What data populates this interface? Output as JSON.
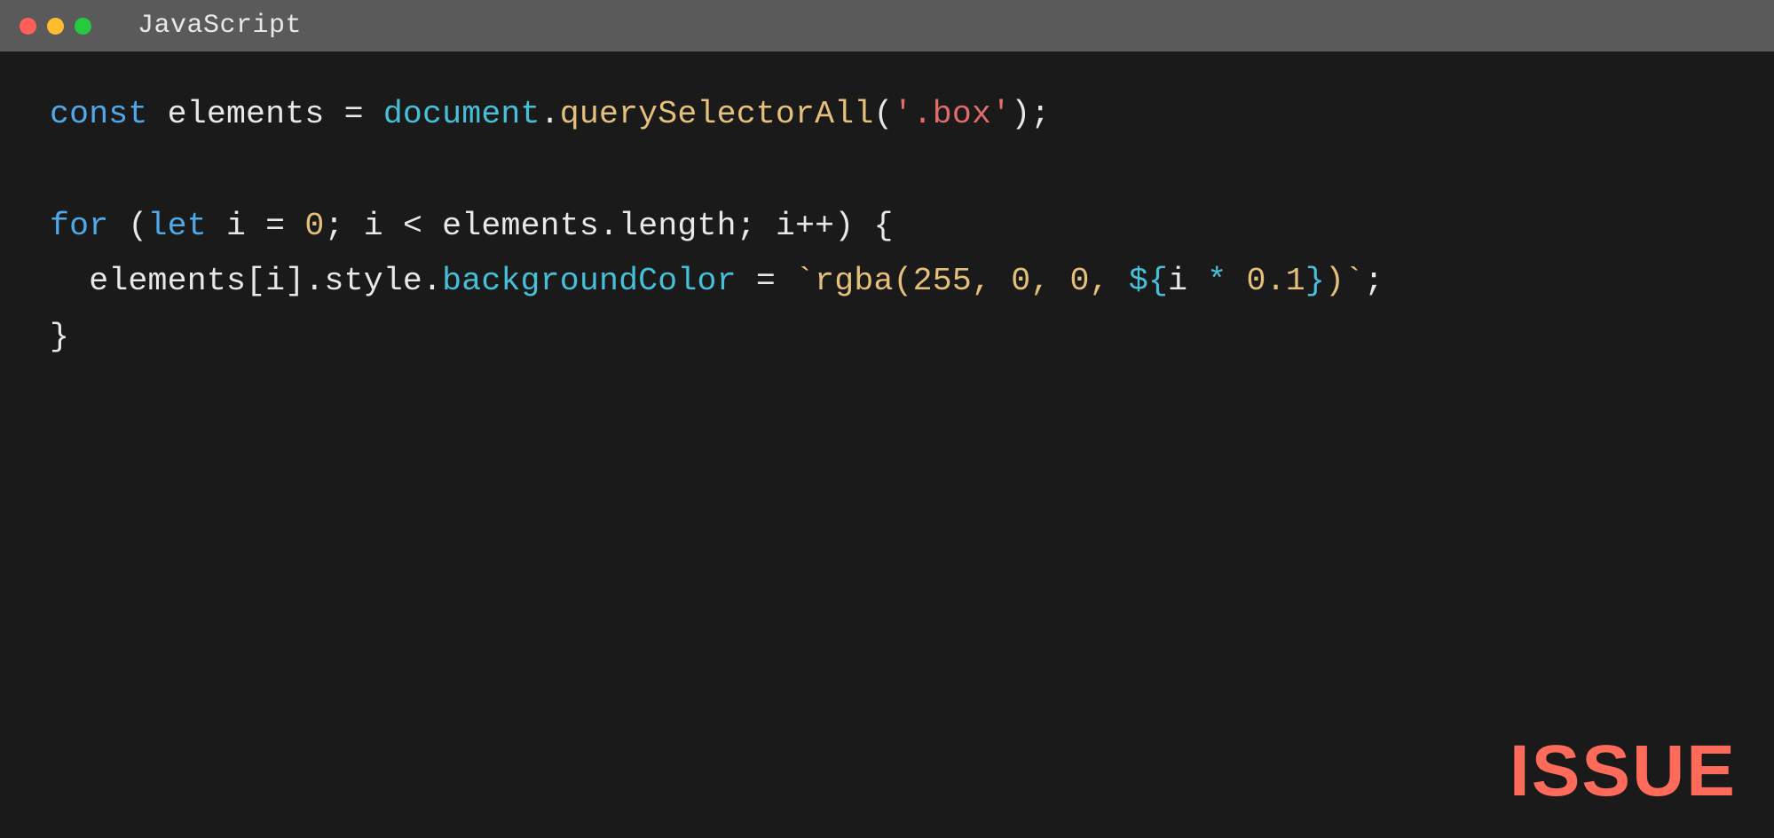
{
  "titlebar": {
    "title": "JavaScript"
  },
  "code": {
    "line1": {
      "const": "const",
      "sp1": " ",
      "elements": "elements",
      "sp2": " ",
      "eq": "=",
      "sp3": " ",
      "document": "document",
      "dot1": ".",
      "querySelectorAll": "querySelectorAll",
      "openp": "(",
      "q1": "'",
      "selector": ".box",
      "q2": "'",
      "closep": ")",
      "semi": ";"
    },
    "line3": {
      "for": "for",
      "sp1": " ",
      "openp": "(",
      "let": "let",
      "sp2": " ",
      "i": "i",
      "sp3": " ",
      "eq": "=",
      "sp4": " ",
      "zero": "0",
      "semi1": ";",
      "sp5": " ",
      "i2": "i",
      "sp6": " ",
      "lt": "<",
      "sp7": " ",
      "elements": "elements",
      "dot": ".",
      "length": "length",
      "semi2": ";",
      "sp8": " ",
      "i3": "i",
      "pp": "++",
      "closep": ")",
      "sp9": " ",
      "brace": "{"
    },
    "line4": {
      "indent": "  ",
      "elements": "elements",
      "openb": "[",
      "i": "i",
      "closeb": "]",
      "dot1": ".",
      "style": "style",
      "dot2": ".",
      "backgroundColor": "backgroundColor",
      "sp1": " ",
      "eq": "=",
      "sp2": " ",
      "bt1": "`",
      "rgba": "rgba(",
      "n255": "255",
      "c1": ", ",
      "n0a": "0",
      "c2": ", ",
      "n0b": "0",
      "c3": ", ",
      "dollar": "$",
      "ob": "{",
      "ii": "i",
      "sp3": " ",
      "star": "*",
      "sp4": " ",
      "n01": "0.1",
      "cb": "}",
      "rp": ")",
      "bt2": "`",
      "semi": ";"
    },
    "line5": {
      "brace": "}"
    }
  },
  "watermark": "ISSUE"
}
